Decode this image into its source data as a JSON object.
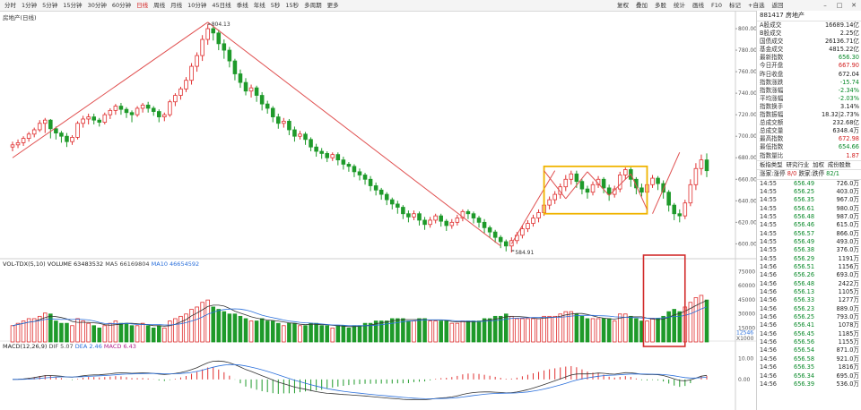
{
  "toolbar": {
    "periods": [
      "分时",
      "1分钟",
      "5分钟",
      "15分钟",
      "30分钟",
      "60分钟",
      "日线",
      "周线",
      "月线",
      "10分钟",
      "45日线",
      "季线",
      "年线",
      "5秒",
      "15秒",
      "多周期",
      "更多"
    ],
    "active_period": "日线",
    "tools": [
      "复权",
      "叠加",
      "多股",
      "统计",
      "画线",
      "F10",
      "标记",
      "+自选",
      "返回"
    ],
    "window_controls": [
      "minimize-icon",
      "maximize-icon",
      "close-icon"
    ]
  },
  "chart": {
    "title": "房地产(日线)",
    "high_label": "804.13",
    "low_label": "584.91",
    "price_axis": [
      "800.00",
      "780.00",
      "760.00",
      "740.00",
      "720.00",
      "700.00",
      "680.00",
      "660.00",
      "640.00",
      "620.00",
      "600.00"
    ],
    "volume_header": {
      "name": "VOL-TDX(5,10)",
      "volume": "VOLUME 63483532",
      "ma5": "MA5 66169804",
      "ma10": "MA10 46654592"
    },
    "volume_axis": [
      "75000",
      "60000",
      "45000",
      "30000",
      "15000"
    ],
    "volume_unit": "X1000",
    "volume_marker": "12546",
    "macd_header": {
      "name": "MACD(12,26,9)",
      "dif": "DIF 5.07",
      "dea": "DEA 2.46",
      "macd": "MACD 6.43"
    },
    "macd_axis": [
      "10.00",
      "0.00"
    ],
    "colors": {
      "up": "#e03030",
      "down": "#1e9a2a",
      "trend": "#e05050",
      "box": "#f0b400",
      "highlight": "#d22c2c",
      "ma_vol_black": "#333333",
      "ma_vol_blue": "#2a6fdb"
    }
  },
  "chart_data": {
    "type": "candlestick",
    "title": "房地产(日线)",
    "ylabel": "",
    "ylim": [
      592,
      810
    ],
    "annotations": {
      "high": 804.13,
      "low": 584.91
    },
    "candles": [
      [
        690,
        692,
        686,
        695,
        0.35
      ],
      [
        692,
        694,
        689,
        697,
        0.4
      ],
      [
        694,
        698,
        691,
        700,
        0.45
      ],
      [
        698,
        702,
        695,
        704,
        0.5
      ],
      [
        702,
        706,
        699,
        708,
        0.5
      ],
      [
        706,
        712,
        704,
        715,
        0.55
      ],
      [
        712,
        715,
        703,
        717,
        0.62
      ],
      [
        715,
        707,
        698,
        716,
        0.6
      ],
      [
        707,
        703,
        697,
        709,
        0.45
      ],
      [
        703,
        700,
        694,
        705,
        0.4
      ],
      [
        700,
        695,
        690,
        703,
        0.4
      ],
      [
        695,
        699,
        692,
        701,
        0.35
      ],
      [
        699,
        712,
        697,
        714,
        0.5
      ],
      [
        712,
        716,
        708,
        719,
        0.45
      ],
      [
        716,
        718,
        711,
        721,
        0.4
      ],
      [
        718,
        715,
        711,
        721,
        0.35
      ],
      [
        715,
        713,
        709,
        717,
        0.3
      ],
      [
        713,
        720,
        711,
        722,
        0.35
      ],
      [
        720,
        724,
        716,
        726,
        0.4
      ],
      [
        724,
        728,
        720,
        730,
        0.45
      ],
      [
        728,
        725,
        720,
        731,
        0.4
      ],
      [
        725,
        722,
        717,
        727,
        0.4
      ],
      [
        722,
        720,
        713,
        724,
        0.35
      ],
      [
        720,
        726,
        718,
        728,
        0.35
      ],
      [
        726,
        729,
        722,
        731,
        0.4
      ],
      [
        729,
        726,
        722,
        732,
        0.35
      ],
      [
        726,
        723,
        719,
        728,
        0.3
      ],
      [
        723,
        718,
        713,
        725,
        0.35
      ],
      [
        718,
        720,
        714,
        722,
        0.3
      ],
      [
        720,
        732,
        718,
        734,
        0.45
      ],
      [
        732,
        738,
        728,
        740,
        0.5
      ],
      [
        738,
        744,
        734,
        746,
        0.55
      ],
      [
        744,
        752,
        741,
        755,
        0.6
      ],
      [
        752,
        765,
        748,
        768,
        0.7
      ],
      [
        765,
        775,
        760,
        778,
        0.75
      ],
      [
        775,
        790,
        770,
        794,
        0.85
      ],
      [
        790,
        800,
        785,
        804,
        0.9
      ],
      [
        800,
        796,
        789,
        802,
        0.75
      ],
      [
        796,
        786,
        780,
        799,
        0.7
      ],
      [
        786,
        780,
        772,
        790,
        0.65
      ],
      [
        780,
        770,
        764,
        783,
        0.6
      ],
      [
        770,
        758,
        752,
        772,
        0.6
      ],
      [
        758,
        750,
        745,
        762,
        0.55
      ],
      [
        750,
        742,
        738,
        754,
        0.5
      ],
      [
        742,
        745,
        736,
        748,
        0.45
      ],
      [
        745,
        738,
        732,
        747,
        0.45
      ],
      [
        738,
        730,
        724,
        741,
        0.5
      ],
      [
        730,
        726,
        721,
        733,
        0.45
      ],
      [
        726,
        718,
        713,
        728,
        0.45
      ],
      [
        718,
        712,
        707,
        721,
        0.4
      ],
      [
        712,
        714,
        708,
        717,
        0.35
      ],
      [
        714,
        706,
        701,
        716,
        0.4
      ],
      [
        706,
        700,
        695,
        709,
        0.4
      ],
      [
        700,
        702,
        697,
        705,
        0.35
      ],
      [
        702,
        697,
        692,
        704,
        0.35
      ],
      [
        697,
        690,
        686,
        699,
        0.4
      ],
      [
        690,
        686,
        681,
        693,
        0.4
      ],
      [
        686,
        684,
        679,
        689,
        0.35
      ],
      [
        684,
        680,
        676,
        686,
        0.35
      ],
      [
        680,
        683,
        677,
        685,
        0.3
      ],
      [
        683,
        678,
        673,
        685,
        0.35
      ],
      [
        678,
        674,
        669,
        681,
        0.35
      ],
      [
        674,
        672,
        667,
        676,
        0.3
      ],
      [
        672,
        667,
        662,
        674,
        0.35
      ],
      [
        667,
        664,
        659,
        670,
        0.35
      ],
      [
        664,
        660,
        655,
        666,
        0.4
      ],
      [
        660,
        654,
        649,
        663,
        0.4
      ],
      [
        654,
        650,
        645,
        657,
        0.45
      ],
      [
        650,
        646,
        641,
        652,
        0.45
      ],
      [
        646,
        641,
        636,
        648,
        0.45
      ],
      [
        641,
        637,
        632,
        643,
        0.5
      ],
      [
        637,
        634,
        628,
        640,
        0.5
      ],
      [
        634,
        628,
        623,
        636,
        0.5
      ],
      [
        628,
        625,
        620,
        631,
        0.45
      ],
      [
        625,
        628,
        622,
        631,
        0.45
      ],
      [
        628,
        622,
        617,
        630,
        0.5
      ],
      [
        622,
        618,
        613,
        625,
        0.5
      ],
      [
        618,
        622,
        615,
        625,
        0.45
      ],
      [
        622,
        626,
        619,
        628,
        0.45
      ],
      [
        626,
        621,
        616,
        628,
        0.45
      ],
      [
        621,
        617,
        612,
        623,
        0.45
      ],
      [
        617,
        620,
        614,
        623,
        0.4
      ],
      [
        620,
        624,
        617,
        627,
        0.4
      ],
      [
        624,
        630,
        621,
        632,
        0.45
      ],
      [
        630,
        628,
        623,
        632,
        0.45
      ],
      [
        628,
        624,
        619,
        630,
        0.45
      ],
      [
        624,
        620,
        615,
        626,
        0.45
      ],
      [
        620,
        615,
        610,
        623,
        0.5
      ],
      [
        615,
        611,
        606,
        617,
        0.5
      ],
      [
        611,
        606,
        601,
        613,
        0.55
      ],
      [
        606,
        602,
        596,
        608,
        0.55
      ],
      [
        602,
        598,
        593,
        604,
        0.6
      ],
      [
        598,
        603,
        592,
        606,
        0.55
      ],
      [
        603,
        608,
        600,
        611,
        0.5
      ],
      [
        608,
        614,
        605,
        617,
        0.5
      ],
      [
        614,
        619,
        611,
        622,
        0.5
      ],
      [
        619,
        624,
        616,
        627,
        0.5
      ],
      [
        624,
        629,
        620,
        632,
        0.5
      ],
      [
        629,
        636,
        626,
        639,
        0.55
      ],
      [
        636,
        641,
        632,
        644,
        0.55
      ],
      [
        641,
        646,
        637,
        649,
        0.55
      ],
      [
        646,
        653,
        642,
        656,
        0.6
      ],
      [
        653,
        660,
        649,
        664,
        0.65
      ],
      [
        660,
        665,
        655,
        668,
        0.65
      ],
      [
        665,
        658,
        652,
        668,
        0.6
      ],
      [
        658,
        651,
        646,
        660,
        0.55
      ],
      [
        651,
        648,
        642,
        654,
        0.5
      ],
      [
        648,
        655,
        645,
        658,
        0.5
      ],
      [
        655,
        660,
        652,
        663,
        0.5
      ],
      [
        660,
        652,
        647,
        662,
        0.5
      ],
      [
        652,
        646,
        640,
        655,
        0.5
      ],
      [
        646,
        651,
        643,
        654,
        0.45
      ],
      [
        651,
        664,
        648,
        667,
        0.6
      ],
      [
        664,
        669,
        660,
        671,
        0.6
      ],
      [
        669,
        660,
        653,
        671,
        0.55
      ],
      [
        660,
        652,
        646,
        662,
        0.5
      ],
      [
        652,
        648,
        644,
        656,
        0.45
      ],
      [
        648,
        655,
        645,
        658,
        0.45
      ],
      [
        655,
        661,
        652,
        664,
        0.5
      ],
      [
        661,
        656,
        650,
        663,
        0.5
      ],
      [
        656,
        648,
        642,
        659,
        0.55
      ],
      [
        648,
        636,
        630,
        650,
        0.65
      ],
      [
        636,
        628,
        622,
        638,
        0.7
      ],
      [
        628,
        626,
        620,
        632,
        0.65
      ],
      [
        626,
        638,
        623,
        641,
        0.75
      ],
      [
        638,
        655,
        635,
        660,
        0.85
      ],
      [
        655,
        670,
        650,
        675,
        0.95
      ],
      [
        670,
        678,
        664,
        683,
        1.0
      ],
      [
        678,
        668,
        662,
        684,
        0.9
      ]
    ],
    "volume": {
      "ylim": [
        0,
        80000
      ],
      "ma5_last": 66169.804,
      "ma10_last": 46654.592
    },
    "macd": {
      "ylim": [
        -12,
        14
      ],
      "dif_last": 5.07,
      "dea_last": 2.46,
      "macd_last": 6.43
    }
  },
  "panel": {
    "code": "881417",
    "name": "房地产",
    "stats": [
      {
        "label": "A股成交",
        "value": "16689.14亿",
        "tone": "ok"
      },
      {
        "label": "B股成交",
        "value": "2.25亿",
        "tone": "ok"
      },
      {
        "label": "国债成交",
        "value": "26136.71亿",
        "tone": "ok"
      },
      {
        "label": "基金成交",
        "value": "4815.22亿",
        "tone": "ok"
      },
      {
        "label": "最新指数",
        "value": "656.30",
        "tone": "grn"
      },
      {
        "label": "今日开盘",
        "value": "667.90",
        "tone": "red"
      },
      {
        "label": "昨日收盘",
        "value": "672.04",
        "tone": "ok"
      },
      {
        "label": "指数涨跌",
        "value": "-15.74",
        "tone": "grn"
      },
      {
        "label": "指数涨幅",
        "value": "-2.34%",
        "tone": "grn"
      },
      {
        "label": "平均涨幅",
        "value": "-2.03%",
        "tone": "grn"
      },
      {
        "label": "指数换手",
        "value": "3.14%",
        "tone": "ok"
      },
      {
        "label": "指数振幅",
        "value": "18.32|2.73%",
        "tone": "ok"
      },
      {
        "label": "总成交额",
        "value": "232.68亿",
        "tone": "ok"
      },
      {
        "label": "总成交量",
        "value": "6348.4万",
        "tone": "ok"
      },
      {
        "label": "最高指数",
        "value": "672.98",
        "tone": "red"
      },
      {
        "label": "最低指数",
        "value": "654.66",
        "tone": "grn"
      },
      {
        "label": "指数量比",
        "value": "1.87",
        "tone": "red"
      }
    ],
    "sector": {
      "label": "板指类型",
      "items": [
        "研究行业",
        "加权",
        "成份股数"
      ]
    },
    "updown": {
      "label": "涨家:涨停",
      "mid": "8/0",
      "label2": "跌家:跌停",
      "value": "82/1"
    },
    "trades": [
      [
        "14:55",
        "656.49",
        "726.0万"
      ],
      [
        "14:55",
        "656.25",
        "403.0万"
      ],
      [
        "14:55",
        "656.35",
        "967.0万"
      ],
      [
        "14:55",
        "656.61",
        "980.0万"
      ],
      [
        "14:55",
        "656.48",
        "987.0万"
      ],
      [
        "14:55",
        "656.46",
        "615.0万"
      ],
      [
        "14:55",
        "656.57",
        "866.0万"
      ],
      [
        "14:55",
        "656.49",
        "493.0万"
      ],
      [
        "14:55",
        "656.38",
        "376.0万"
      ],
      [
        "14:55",
        "656.29",
        "1191万"
      ],
      [
        "14:56",
        "656.51",
        "1156万"
      ],
      [
        "14:56",
        "656.26",
        "693.0万"
      ],
      [
        "14:56",
        "656.48",
        "2422万"
      ],
      [
        "14:56",
        "656.13",
        "1105万"
      ],
      [
        "14:56",
        "656.33",
        "1277万"
      ],
      [
        "14:56",
        "656.23",
        "889.0万"
      ],
      [
        "14:56",
        "656.25",
        "793.0万"
      ],
      [
        "14:56",
        "656.41",
        "1078万"
      ],
      [
        "14:56",
        "656.45",
        "1185万"
      ],
      [
        "14:56",
        "656.56",
        "1155万"
      ],
      [
        "14:56",
        "656.54",
        "871.0万"
      ],
      [
        "14:56",
        "656.58",
        "921.0万"
      ],
      [
        "14:56",
        "656.35",
        "1816万"
      ],
      [
        "14:56",
        "656.34",
        "695.0万"
      ],
      [
        "14:56",
        "656.39",
        "536.0万"
      ]
    ]
  }
}
